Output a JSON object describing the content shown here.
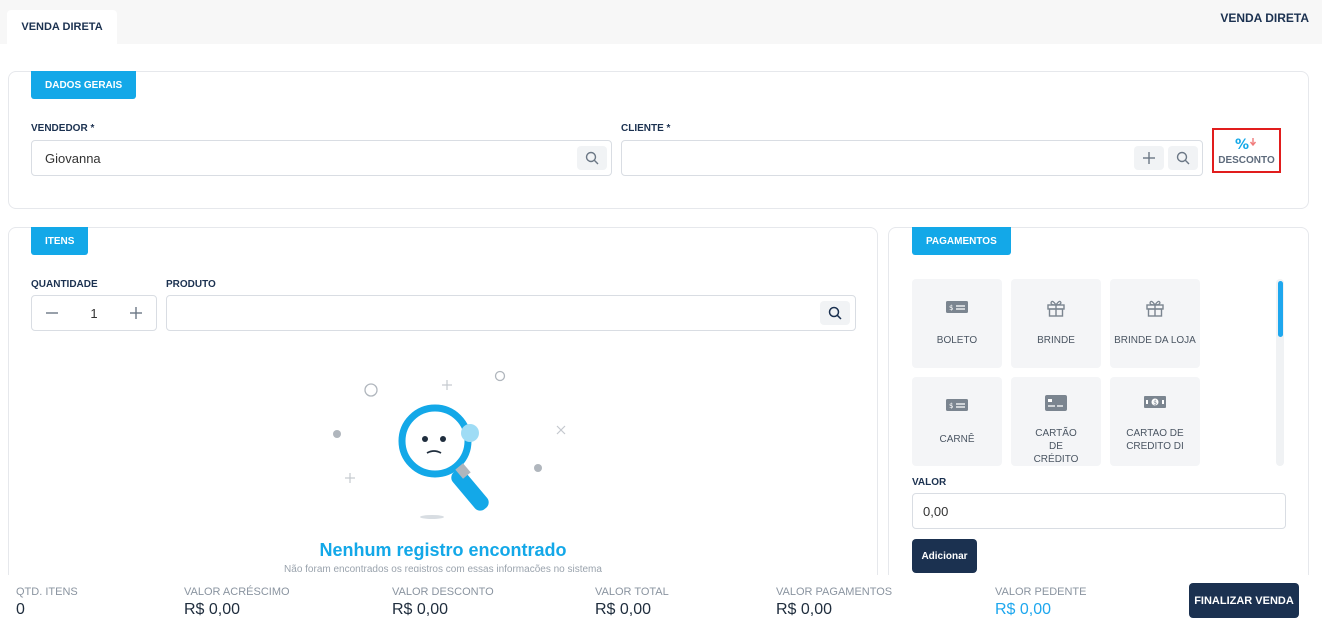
{
  "tabs": [
    {
      "label": "VENDA DIRETA",
      "active": true
    }
  ],
  "page_title": "VENDA DIRETA",
  "general": {
    "section_label": "DADOS GERAIS",
    "seller_label": "VENDEDOR *",
    "seller_value": "Giovanna",
    "client_label": "CLIENTE *",
    "client_value": "",
    "discount_label": "DESCONTO"
  },
  "items": {
    "section_label": "ITENS",
    "quantity_label": "QUANTIDADE",
    "quantity_value": "1",
    "product_label": "PRODUTO",
    "product_value": "",
    "empty_title": "Nenhum registro encontrado",
    "empty_subtitle": "Não foram encontrados os registros com essas informações no sistema"
  },
  "payments": {
    "section_label": "PAGAMENTOS",
    "methods": [
      {
        "label": "BOLETO",
        "icon": "money-bill-icon"
      },
      {
        "label": "BRINDE",
        "icon": "gift-icon"
      },
      {
        "label": "BRINDE DA LOJA",
        "icon": "gift-icon"
      },
      {
        "label": "CARNÊ",
        "icon": "money-bill-icon"
      },
      {
        "label": "CARTÃO DE CRÉDITO",
        "icon": "credit-card-icon"
      },
      {
        "label": "CARTAO DE CREDITO DI",
        "icon": "cash-icon"
      }
    ],
    "value_label": "VALOR",
    "value": "0,00",
    "add_label": "Adicionar"
  },
  "footer": {
    "qty_items_label": "QTD. ITENS",
    "qty_items_value": "0",
    "surcharge_label": "VALOR ACRÉSCIMO",
    "surcharge_value": "R$ 0,00",
    "discount_label": "VALOR DESCONTO",
    "discount_value": "R$ 0,00",
    "total_label": "VALOR TOTAL",
    "total_value": "R$ 0,00",
    "payments_label": "VALOR PAGAMENTOS",
    "payments_value": "R$ 0,00",
    "pending_label": "VALOR PEDENTE",
    "pending_value": "R$ 0,00",
    "finish_label": "FINALIZAR VENDA"
  },
  "colors": {
    "accent": "#13a8e8",
    "navy": "#1b3150",
    "highlight": "#e11d1d"
  }
}
